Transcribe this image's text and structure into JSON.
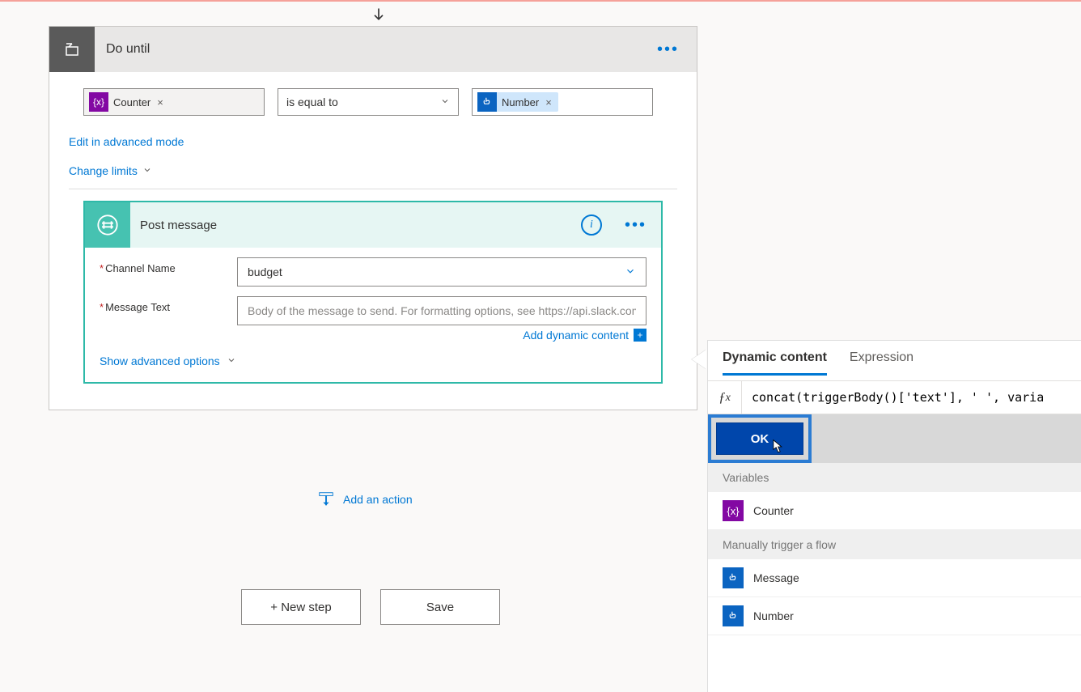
{
  "do_until": {
    "title": "Do until",
    "left_token": "Counter",
    "operator": "is equal to",
    "right_token": "Number",
    "edit_advanced": "Edit in advanced mode",
    "change_limits": "Change limits"
  },
  "post_message": {
    "title": "Post message",
    "channel_label": "Channel Name",
    "channel_value": "budget",
    "message_label": "Message Text",
    "message_placeholder": "Body of the message to send. For formatting options, see https://api.slack.com,",
    "add_dynamic": "Add dynamic content",
    "show_advanced": "Show advanced options"
  },
  "footer": {
    "add_action": "Add an action",
    "new_step": "+ New step",
    "save": "Save"
  },
  "flyout": {
    "tab_dynamic": "Dynamic content",
    "tab_expression": "Expression",
    "formula": "concat(triggerBody()['text'], ' ', varia",
    "ok": "OK",
    "section_variables": "Variables",
    "item_counter": "Counter",
    "section_manual": "Manually trigger a flow",
    "item_message": "Message",
    "item_number": "Number"
  }
}
